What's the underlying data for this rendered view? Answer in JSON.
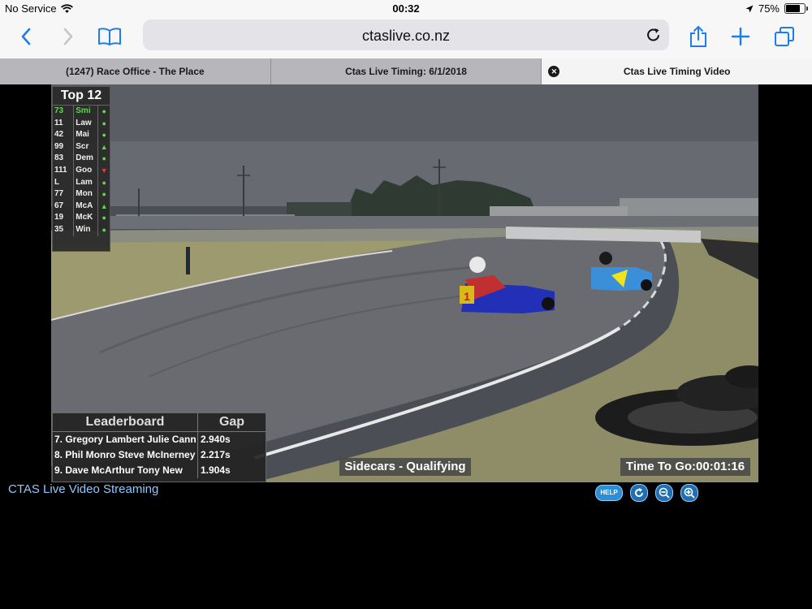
{
  "status_bar": {
    "carrier": "No Service",
    "time": "00:32",
    "battery_percent_label": "75%",
    "battery_level": 0.75
  },
  "toolbar": {
    "url": "ctaslive.co.nz",
    "icons": [
      "back-icon",
      "forward-icon",
      "bookmarks-icon",
      "reload-icon",
      "share-icon",
      "new-tab-icon",
      "tabs-icon"
    ]
  },
  "tabs": [
    {
      "label": "(1247) Race Office - The Place",
      "active": false
    },
    {
      "label": "Ctas Live Timing: 6/1/2018",
      "active": false
    },
    {
      "label": "Ctas Live Timing Video",
      "active": true
    }
  ],
  "video": {
    "top12": {
      "title": "Top 12",
      "rows": [
        {
          "num": "73",
          "name": "Smi",
          "trend": "same"
        },
        {
          "num": "11",
          "name": "Law",
          "trend": "same"
        },
        {
          "num": "42",
          "name": "Mai",
          "trend": "same"
        },
        {
          "num": "99",
          "name": "Scr",
          "trend": "up"
        },
        {
          "num": "83",
          "name": "Dem",
          "trend": "same"
        },
        {
          "num": "111",
          "name": "Goo",
          "trend": "down"
        },
        {
          "num": "L",
          "name": "Lam",
          "trend": "same"
        },
        {
          "num": "77",
          "name": "Mon",
          "trend": "same"
        },
        {
          "num": "67",
          "name": "McA",
          "trend": "up"
        },
        {
          "num": "19",
          "name": "McK",
          "trend": "same"
        },
        {
          "num": "35",
          "name": "Win",
          "trend": "same"
        }
      ]
    },
    "leaderboard": {
      "title": "Leaderboard",
      "gap_header": "Gap",
      "rows": [
        {
          "driver": "7. Gregory Lambert Julie Cann",
          "gap": "2.940s"
        },
        {
          "driver": "8. Phil Monro Steve McInerney",
          "gap": "2.217s"
        },
        {
          "driver": "9. Dave McArthur Tony New",
          "gap": "1.904s"
        }
      ]
    },
    "session": "Sidecars - Qualifying",
    "time_to_go": "Time To Go:00:01:16",
    "sidecar_number": "1"
  },
  "footer": {
    "label": "CTAS Live Video Streaming",
    "help_label": "HELP",
    "control_icons": [
      "refresh-icon",
      "zoom-out-icon",
      "zoom-in-icon"
    ]
  },
  "colors": {
    "accent": "#1e7cf0",
    "leader_green": "#5dd84a",
    "trend_down_red": "#e03b3b"
  }
}
